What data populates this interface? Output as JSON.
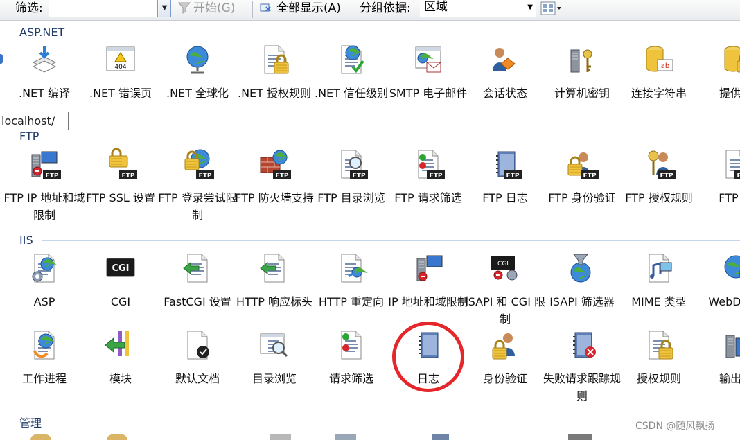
{
  "toolbar": {
    "filter_label": "筛选:",
    "filter_value": "",
    "start_label": "开始(G)",
    "showall_label": "全部显示(A)",
    "groupby_label": "分组依据:",
    "groupby_value": "区域"
  },
  "tooltip": "localhost/",
  "watermark": "CSDN @随风飘扬",
  "sections": [
    {
      "title": "ASP.NET",
      "items": [
        {
          "label": ".NET 编译",
          "icon": "dotnet-compile-icon"
        },
        {
          "label": ".NET 错误页",
          "icon": "error-page-404-icon"
        },
        {
          "label": ".NET 全球化",
          "icon": "globe-icon"
        },
        {
          "label": ".NET 授权规则",
          "icon": "authorization-lock-icon"
        },
        {
          "label": ".NET 信任级别",
          "icon": "trust-level-icon"
        },
        {
          "label": "SMTP 电子邮件",
          "icon": "smtp-email-icon"
        },
        {
          "label": "会话状态",
          "icon": "session-state-icon"
        },
        {
          "label": "计算机密钥",
          "icon": "machine-key-icon"
        },
        {
          "label": "连接字符串",
          "icon": "connection-string-icon"
        },
        {
          "label": "提供程",
          "icon": "providers-icon"
        }
      ]
    },
    {
      "title": "FTP",
      "items": [
        {
          "label": "FTP IP 地址和域限制",
          "icon": "ftp-ip-restriction-icon"
        },
        {
          "label": "FTP SSL 设置",
          "icon": "ftp-ssl-lock-icon"
        },
        {
          "label": "FTP 登录尝试限制",
          "icon": "ftp-logon-limit-icon"
        },
        {
          "label": "FTP 防火墙支持",
          "icon": "ftp-firewall-icon"
        },
        {
          "label": "FTP 目录浏览",
          "icon": "ftp-directory-browse-icon"
        },
        {
          "label": "FTP 请求筛选",
          "icon": "ftp-request-filter-icon"
        },
        {
          "label": "FTP 日志",
          "icon": "ftp-log-icon"
        },
        {
          "label": "FTP 身份验证",
          "icon": "ftp-authentication-icon"
        },
        {
          "label": "FTP 授权规则",
          "icon": "ftp-authorization-icon"
        },
        {
          "label": "FTP 消",
          "icon": "ftp-messages-icon"
        }
      ]
    },
    {
      "title": "IIS",
      "items": [
        {
          "label": "ASP",
          "icon": "asp-icon"
        },
        {
          "label": "CGI",
          "icon": "cgi-icon"
        },
        {
          "label": "FastCGI 设置",
          "icon": "fastcgi-icon"
        },
        {
          "label": "HTTP 响应标头",
          "icon": "http-response-headers-icon"
        },
        {
          "label": "HTTP 重定向",
          "icon": "http-redirect-icon"
        },
        {
          "label": "IP 地址和域限制",
          "icon": "ip-restriction-icon"
        },
        {
          "label": "ISAPI 和 CGI 限制",
          "icon": "isapi-cgi-restriction-icon"
        },
        {
          "label": "ISAPI 筛选器",
          "icon": "isapi-filter-icon"
        },
        {
          "label": "MIME 类型",
          "icon": "mime-types-icon"
        },
        {
          "label": "WebD作规",
          "icon": "webdav-icon"
        },
        {
          "label": "工作进程",
          "icon": "worker-process-icon"
        },
        {
          "label": "模块",
          "icon": "modules-icon"
        },
        {
          "label": "默认文档",
          "icon": "default-document-icon"
        },
        {
          "label": "目录浏览",
          "icon": "directory-browse-icon"
        },
        {
          "label": "请求筛选",
          "icon": "request-filter-icon"
        },
        {
          "label": "日志",
          "icon": "log-icon"
        },
        {
          "label": "身份验证",
          "icon": "authentication-icon"
        },
        {
          "label": "失败请求跟踪规则",
          "icon": "failed-request-tracing-icon"
        },
        {
          "label": "授权规则",
          "icon": "authorization-rules-icon"
        },
        {
          "label": "输出缓",
          "icon": "output-caching-icon"
        }
      ]
    },
    {
      "title": "管理",
      "items": []
    }
  ],
  "colors": {
    "section_title": "#1e3a6a",
    "highlight_circle": "#e5272b"
  }
}
